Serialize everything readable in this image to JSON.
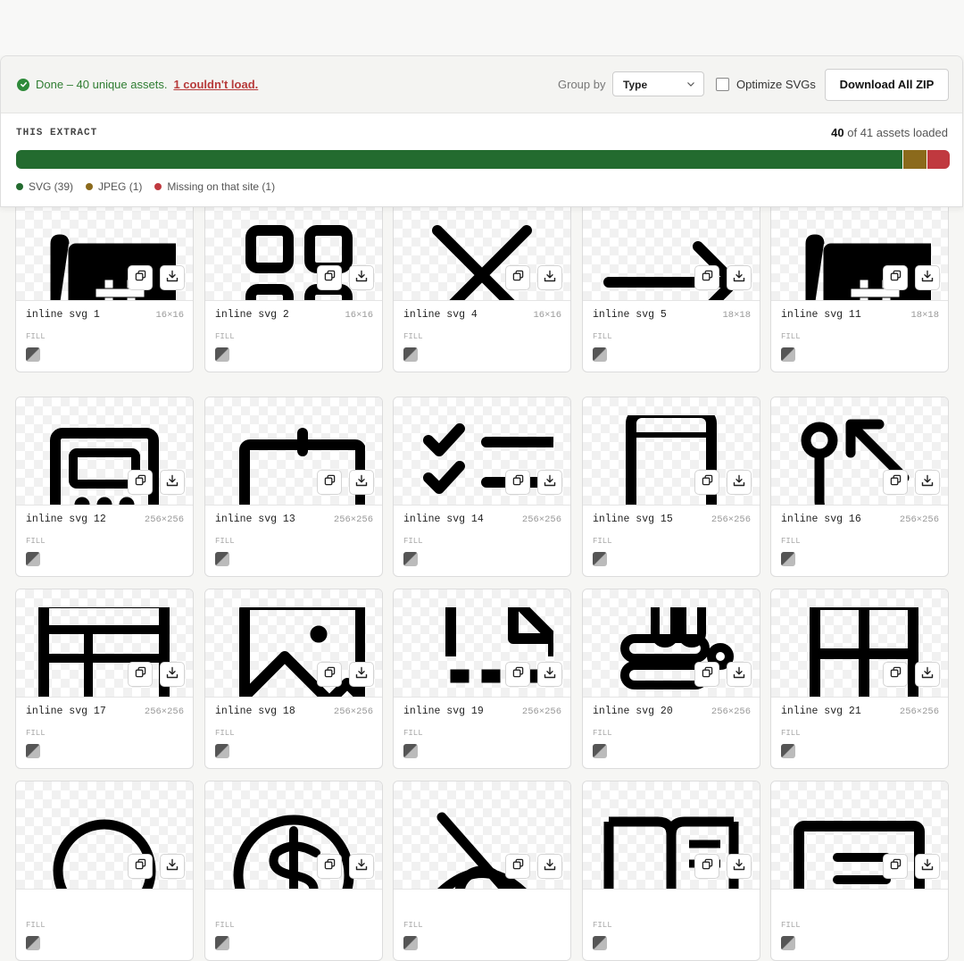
{
  "status": {
    "message": "Done – 40 unique assets.",
    "error_link": "1 couldn't load."
  },
  "toolbar": {
    "group_by_label": "Group by",
    "group_by_value": "Type",
    "optimize_label": "Optimize SVGs",
    "optimize_checked": false,
    "download_all_label": "Download All ZIP"
  },
  "extract": {
    "title": "THIS EXTRACT",
    "loaded_count": "40",
    "loaded_rest": "of 41 assets loaded",
    "segments": [
      {
        "label": "SVG (39)",
        "count": 39,
        "color": "#236b2f"
      },
      {
        "label": "JPEG (1)",
        "count": 1,
        "color": "#8b6a1c"
      },
      {
        "label": "Missing on that site (1)",
        "count": 1,
        "color": "#c0393f"
      }
    ]
  },
  "card_fill_label": "FILL",
  "assets": [
    {
      "name": "inline svg 1",
      "dims": "16×16",
      "icon": "fax-icon"
    },
    {
      "name": "inline svg 2",
      "dims": "16×16",
      "icon": "grid-icon"
    },
    {
      "name": "inline svg 4",
      "dims": "16×16",
      "icon": "x-icon"
    },
    {
      "name": "inline svg 5",
      "dims": "18×18",
      "icon": "arrow-right-icon"
    },
    {
      "name": "inline svg 11",
      "dims": "18×18",
      "icon": "fax-icon"
    },
    {
      "name": "inline svg 12",
      "dims": "256×256",
      "icon": "cash-register-icon"
    },
    {
      "name": "inline svg 13",
      "dims": "256×256",
      "icon": "calendar-icon"
    },
    {
      "name": "inline svg 14",
      "dims": "256×256",
      "icon": "checklist-icon"
    },
    {
      "name": "inline svg 15",
      "dims": "256×256",
      "icon": "device-mobile-icon"
    },
    {
      "name": "inline svg 16",
      "dims": "256×256",
      "icon": "route-icon"
    },
    {
      "name": "inline svg 17",
      "dims": "256×256",
      "icon": "table-icon"
    },
    {
      "name": "inline svg 18",
      "dims": "256×256",
      "icon": "image-icon"
    },
    {
      "name": "inline svg 19",
      "dims": "256×256",
      "icon": "file-icon"
    },
    {
      "name": "inline svg 20",
      "dims": "256×256",
      "icon": "slack-logo-icon"
    },
    {
      "name": "inline svg 21",
      "dims": "256×256",
      "icon": "grid-four-icon"
    },
    {
      "name": "",
      "dims": "",
      "icon": "circle-icon"
    },
    {
      "name": "",
      "dims": "",
      "icon": "currency-dollar-icon"
    },
    {
      "name": "",
      "dims": "",
      "icon": "eye-slash-icon"
    },
    {
      "name": "",
      "dims": "",
      "icon": "book-open-icon"
    },
    {
      "name": "",
      "dims": "",
      "icon": "article-icon"
    }
  ]
}
